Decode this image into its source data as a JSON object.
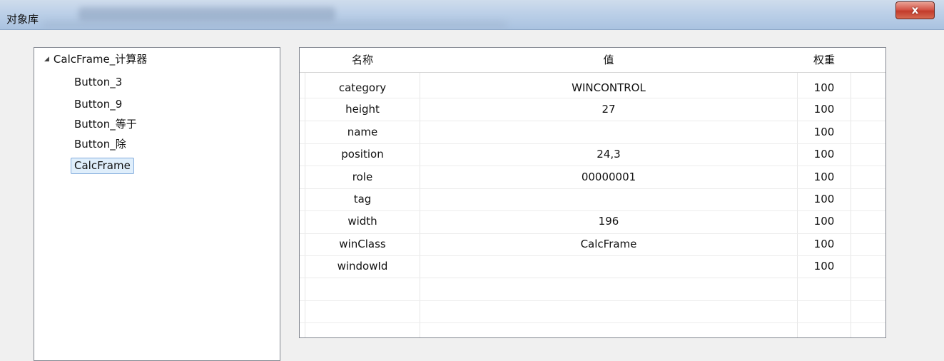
{
  "window": {
    "title": "对象库",
    "close_label": "x"
  },
  "tree": {
    "root_label": "CalcFrame_计算器",
    "toggle_glyph": "◢",
    "children": [
      {
        "label": "Button_3",
        "selected": false
      },
      {
        "label": "Button_9",
        "selected": false
      },
      {
        "label": "Button_等于",
        "selected": false
      },
      {
        "label": "Button_除",
        "selected": false
      },
      {
        "label": "CalcFrame",
        "selected": true
      }
    ]
  },
  "grid": {
    "headers": {
      "name": "名称",
      "value": "值",
      "weight": "权重"
    },
    "rows": [
      {
        "name": "category",
        "value": "WINCONTROL",
        "weight": "100"
      },
      {
        "name": "height",
        "value": "27",
        "weight": "100"
      },
      {
        "name": "name",
        "value": "",
        "weight": "100"
      },
      {
        "name": "position",
        "value": "24,3",
        "weight": "100"
      },
      {
        "name": "role",
        "value": "00000001",
        "weight": "100"
      },
      {
        "name": "tag",
        "value": "",
        "weight": "100"
      },
      {
        "name": "width",
        "value": "196",
        "weight": "100"
      },
      {
        "name": "winClass",
        "value": "CalcFrame",
        "weight": "100"
      },
      {
        "name": "windowId",
        "value": "",
        "weight": "100"
      }
    ]
  },
  "colors": {
    "titlebar": "#bcd0e8",
    "selection_bg": "#dfeefb",
    "selection_border": "#84acdd",
    "close_button": "#c23b2b"
  }
}
